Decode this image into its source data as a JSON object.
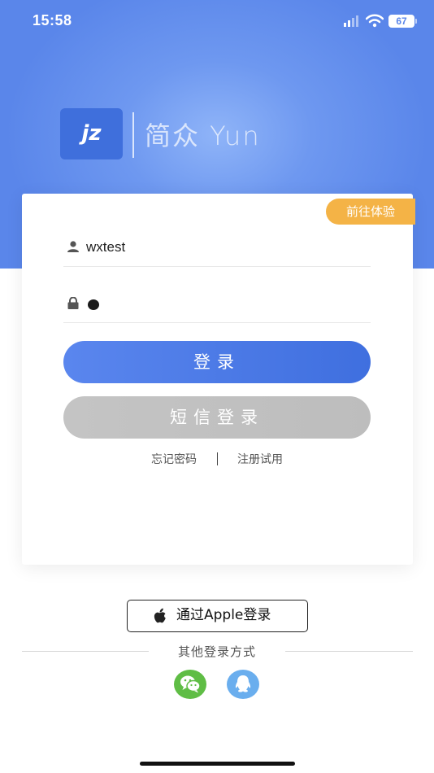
{
  "status_bar": {
    "time": "15:58",
    "battery": "67"
  },
  "logo": {
    "mark": "jz",
    "name": "简众 Yun"
  },
  "try_badge": "前往体验",
  "login": {
    "username_value": "wxtest",
    "password_value": "",
    "login_button": "登录",
    "sms_button": "短信登录",
    "forgot_link": "忘记密码",
    "register_link": "注册试用"
  },
  "apple_login": "通过Apple登录",
  "other_methods": {
    "label": "其他登录方式",
    "icons": [
      "wechat-icon",
      "qq-icon"
    ]
  },
  "colors": {
    "primary": "#3f6fdf",
    "badge": "#f4b346",
    "wechat": "#5fbd45",
    "qq": "#6aaeee"
  }
}
